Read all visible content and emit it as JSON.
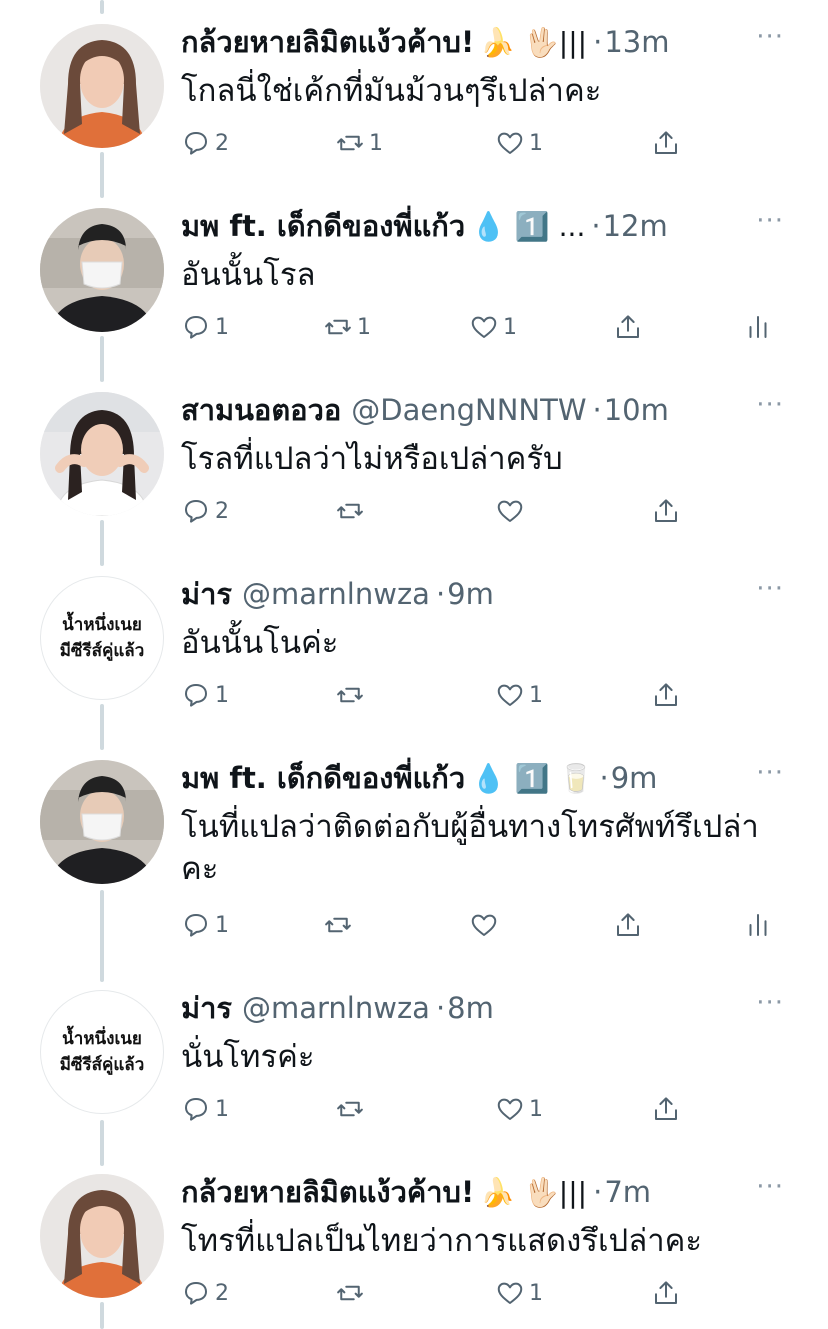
{
  "tweets": [
    {
      "name": "กล้วยหายลิมิตแง้วค้าบ!",
      "emojis": "🍌 🖖🏻|||",
      "handle": "",
      "time": "13m",
      "text": "โกลนี่ใช่เค้กที่มันม้วนๆรึเปล่าคะ",
      "reply": "2",
      "retweet": "1",
      "like": "1",
      "share": "",
      "avatar": "photo-girl-orange"
    },
    {
      "name": "มพ ft. เด็กดีของพี่แก้ว",
      "emojis": "💧 1️⃣ ...",
      "handle": "",
      "time": "12m",
      "text": "อันนั้นโรล",
      "reply": "1",
      "retweet": "1",
      "like": "1",
      "share": "",
      "avatar": "photo-boy-mask",
      "analytics": true
    },
    {
      "name": "สามนอตอวอ",
      "emojis": "",
      "handle": "@DaengNNNTW",
      "time": "10m",
      "text": "โรลที่แปลว่าไม่หรือเปล่าครับ",
      "reply": "2",
      "retweet": "",
      "like": "",
      "share": "",
      "avatar": "photo-girl-white"
    },
    {
      "name": "ม่าร",
      "emojis": "",
      "handle": "@marnlnwza",
      "time": "9m",
      "text": "อันนั้นโนค่ะ",
      "reply": "1",
      "retweet": "",
      "like": "1",
      "share": "",
      "avatar": "text",
      "avatar_text": [
        "น้ำหนึ่งเนย",
        "มีซีรีส์คู่แล้ว"
      ]
    },
    {
      "name": "มพ ft. เด็กดีของพี่แก้ว",
      "emojis": "💧 1️⃣ 🥛",
      "handle": "",
      "time": "9m",
      "text": "โนที่แปลว่าติดต่อกับผู้อื่นทางโทรศัพท์รึเปล่าคะ",
      "reply": "1",
      "retweet": "",
      "like": "",
      "share": "",
      "avatar": "photo-boy-mask",
      "analytics": true
    },
    {
      "name": "ม่าร",
      "emojis": "",
      "handle": "@marnlnwza",
      "time": "8m",
      "text": "นั่นโทรค่ะ",
      "reply": "1",
      "retweet": "",
      "like": "1",
      "share": "",
      "avatar": "text",
      "avatar_text": [
        "น้ำหนึ่งเนย",
        "มีซีรีส์คู่แล้ว"
      ]
    },
    {
      "name": "กล้วยหายลิมิตแง้วค้าบ!",
      "emojis": "🍌 🖖🏻|||",
      "handle": "",
      "time": "7m",
      "text": "โทรที่แปลเป็นไทยว่าการแสดงรึเปล่าคะ",
      "reply": "2",
      "retweet": "",
      "like": "1",
      "share": "",
      "avatar": "photo-girl-orange"
    }
  ],
  "ui": {
    "separator": "·",
    "more": "···"
  },
  "colors": {
    "text": "#0f1419",
    "muted": "#536471",
    "thread_line": "#cfd9de"
  }
}
